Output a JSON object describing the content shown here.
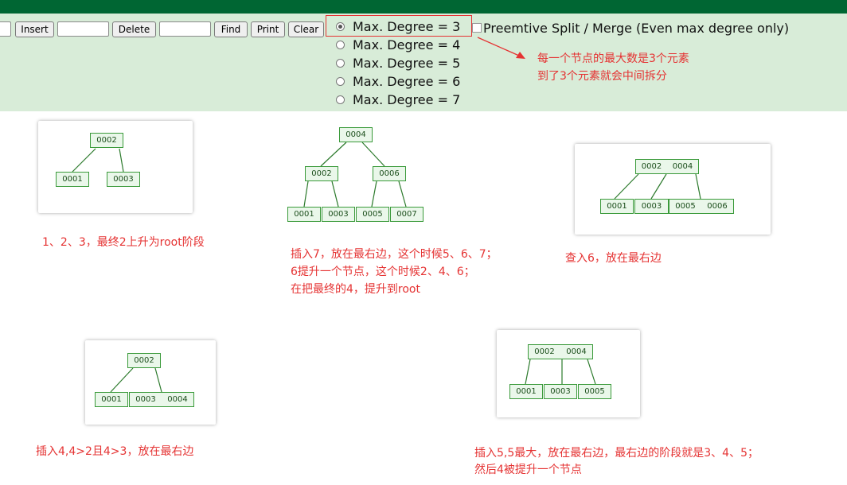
{
  "controls": {
    "insert_label": "Insert",
    "delete_label": "Delete",
    "find_label": "Find",
    "print_label": "Print",
    "clear_label": "Clear",
    "degree_options": [
      "Max. Degree = 3",
      "Max. Degree = 4",
      "Max. Degree = 5",
      "Max. Degree = 6",
      "Max. Degree = 7"
    ],
    "selected_degree_index": 0,
    "preemptive_label": "Preemtive Split / Merge (Even max degree only)",
    "preemptive_checked": false
  },
  "annotation": {
    "line1": "每一个节点的最大数是3个元素",
    "line2": "到了3个元素就会中间拆分"
  },
  "diagrams": [
    {
      "root": "0002",
      "left": "0001",
      "right": "0003",
      "caption": "1、2、3，最终2上升为root阶段"
    },
    {
      "root": "0004",
      "mid_left": "0002",
      "mid_right": "0006",
      "leaves": [
        "0001",
        "0003",
        "0005",
        "0007"
      ],
      "caption_lines": [
        "插入7，放在最右边，这个时候5、6、7；",
        "6提升一个节点，这个时候2、4、6；",
        "在把最终的4，提升到root"
      ]
    },
    {
      "root": [
        "0002",
        "0004"
      ],
      "leaves": [
        "0001",
        "0003",
        "0005",
        "0006"
      ],
      "caption": "查入6，放在最右边"
    },
    {
      "root": "0002",
      "left": "0001",
      "right": [
        "0003",
        "0004"
      ],
      "caption": "插入4,4>2且4>3，放在最右边"
    },
    {
      "root": [
        "0002",
        "0004"
      ],
      "leaves": [
        "0001",
        "0003",
        "0005"
      ],
      "caption_lines": [
        "插入5,5最大，放在最右边，最右边的阶段就是3、4、5；",
        "然后4被提升一个节点"
      ]
    }
  ]
}
